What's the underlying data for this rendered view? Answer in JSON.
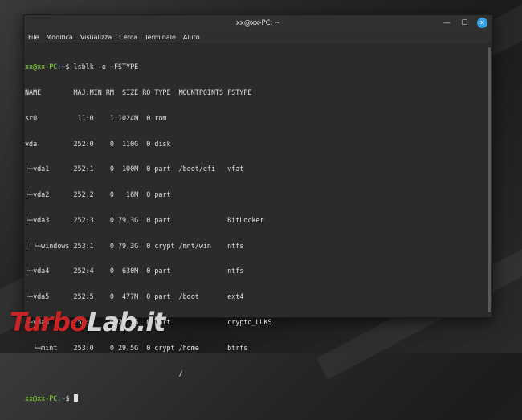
{
  "window": {
    "title": "xx@xx-PC: ~"
  },
  "menu": [
    "File",
    "Modifica",
    "Visualizza",
    "Cerca",
    "Terminale",
    "Aiuto"
  ],
  "terminal": {
    "prompt_user": "xx@xx-PC",
    "prompt_path": ":~",
    "prompt_symbol": "$",
    "command": " lsblk -o +FSTYPE",
    "output": [
      "NAME        MAJ:MIN RM  SIZE RO TYPE  MOUNTPOINTS FSTYPE",
      "sr0          11:0    1 1024M  0 rom",
      "vda         252:0    0  110G  0 disk",
      "├─vda1      252:1    0  100M  0 part  /boot/efi   vfat",
      "├─vda2      252:2    0   16M  0 part",
      "├─vda3      252:3    0 79,3G  0 part              BitLocker",
      "│ └─windows 253:1    0 79,3G  0 crypt /mnt/win    ntfs",
      "├─vda4      252:4    0  630M  0 part              ntfs",
      "├─vda5      252:5    0  477M  0 part  /boot       ext4",
      "└─vda6      252:6    0 29,5G  0 part              crypto_LUKS",
      "  └─mint    253:0    0 29,5G  0 crypt /home       btrfs",
      "                                      /"
    ]
  },
  "watermark": {
    "part1": "Turbo",
    "part2": "Lab.it"
  }
}
